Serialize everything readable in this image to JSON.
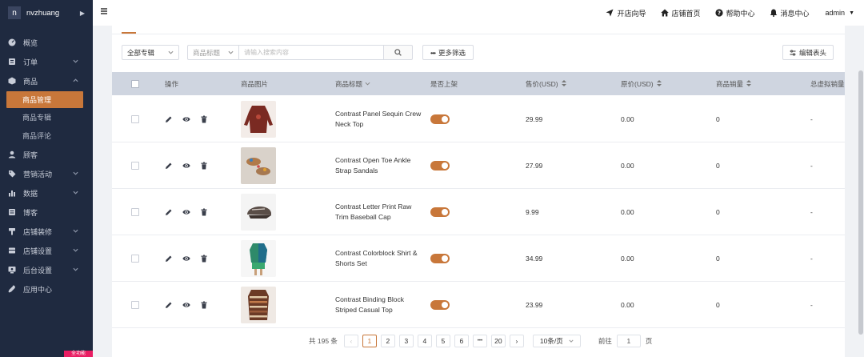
{
  "brand": {
    "logo": "n",
    "name": "nvzhuang"
  },
  "sidebar": {
    "items": [
      {
        "label": "概览",
        "icon": "dashboard-icon",
        "has_children": false
      },
      {
        "label": "订单",
        "icon": "order-icon",
        "has_children": true,
        "expanded": false
      },
      {
        "label": "商品",
        "icon": "product-icon",
        "has_children": true,
        "expanded": true
      },
      {
        "label": "顾客",
        "icon": "customer-icon",
        "has_children": false
      },
      {
        "label": "营销活动",
        "icon": "marketing-icon",
        "has_children": true,
        "expanded": false
      },
      {
        "label": "数据",
        "icon": "data-icon",
        "has_children": true,
        "expanded": false
      },
      {
        "label": "博客",
        "icon": "blog-icon",
        "has_children": false
      },
      {
        "label": "店铺装修",
        "icon": "decoration-icon",
        "has_children": true,
        "expanded": false
      },
      {
        "label": "店铺设置",
        "icon": "shop-settings-icon",
        "has_children": true,
        "expanded": false
      },
      {
        "label": "后台设置",
        "icon": "admin-settings-icon",
        "has_children": true,
        "expanded": false
      },
      {
        "label": "应用中心",
        "icon": "app-center-icon",
        "has_children": false
      }
    ],
    "product_sub": [
      {
        "label": "商品管理",
        "active": true
      },
      {
        "label": "商品专辑",
        "active": false
      },
      {
        "label": "商品评论",
        "active": false
      }
    ],
    "badge": "全功能"
  },
  "topbar": {
    "links": [
      {
        "label": "开店向导",
        "icon": "send-icon"
      },
      {
        "label": "店铺首页",
        "icon": "home-icon"
      },
      {
        "label": "帮助中心",
        "icon": "help-icon"
      },
      {
        "label": "消息中心",
        "icon": "bell-icon"
      }
    ],
    "user": "admin"
  },
  "filters": {
    "album_select": "全部专辑",
    "field_select": "商品标题",
    "search_placeholder": "请输入搜索内容",
    "more_filter": "更多筛选",
    "edit_columns": "编辑表头"
  },
  "table": {
    "headers": {
      "action": "操作",
      "image": "商品图片",
      "title": "商品标题",
      "listed": "是否上架",
      "price": "售价(USD)",
      "cost": "原价(USD)",
      "sales": "商品销量",
      "virtual_sales": "总虚拟销量"
    },
    "rows": [
      {
        "title": "Contrast Panel Sequin Crew Neck Top",
        "listed": true,
        "price": "29.99",
        "cost": "0.00",
        "sales": "0",
        "virtual_sales": "-",
        "thumb_color": "#7a2a22"
      },
      {
        "title": "Contrast Open Toe Ankle Strap Sandals",
        "listed": true,
        "price": "27.99",
        "cost": "0.00",
        "sales": "0",
        "virtual_sales": "-",
        "thumb_color": "#b07a4a"
      },
      {
        "title": "Contrast Letter Print Raw Trim Baseball Cap",
        "listed": true,
        "price": "9.99",
        "cost": "0.00",
        "sales": "0",
        "virtual_sales": "-",
        "thumb_color": "#5a4e48"
      },
      {
        "title": "Contrast Colorblock Shirt & Shorts Set",
        "listed": true,
        "price": "34.99",
        "cost": "0.00",
        "sales": "0",
        "virtual_sales": "-",
        "thumb_color": "#2e8a6a"
      },
      {
        "title": "Contrast Binding Block Striped Casual Top",
        "listed": true,
        "price": "23.99",
        "cost": "0.00",
        "sales": "0",
        "virtual_sales": "-",
        "thumb_color": "#6b3a26"
      }
    ]
  },
  "pagination": {
    "total": "共 195 条",
    "pages": [
      "1",
      "2",
      "3",
      "4",
      "5",
      "6",
      "•••",
      "20"
    ],
    "current": "1",
    "page_size": "10条/页",
    "goto_label": "前往",
    "goto_value": "1",
    "goto_suffix": "页"
  }
}
